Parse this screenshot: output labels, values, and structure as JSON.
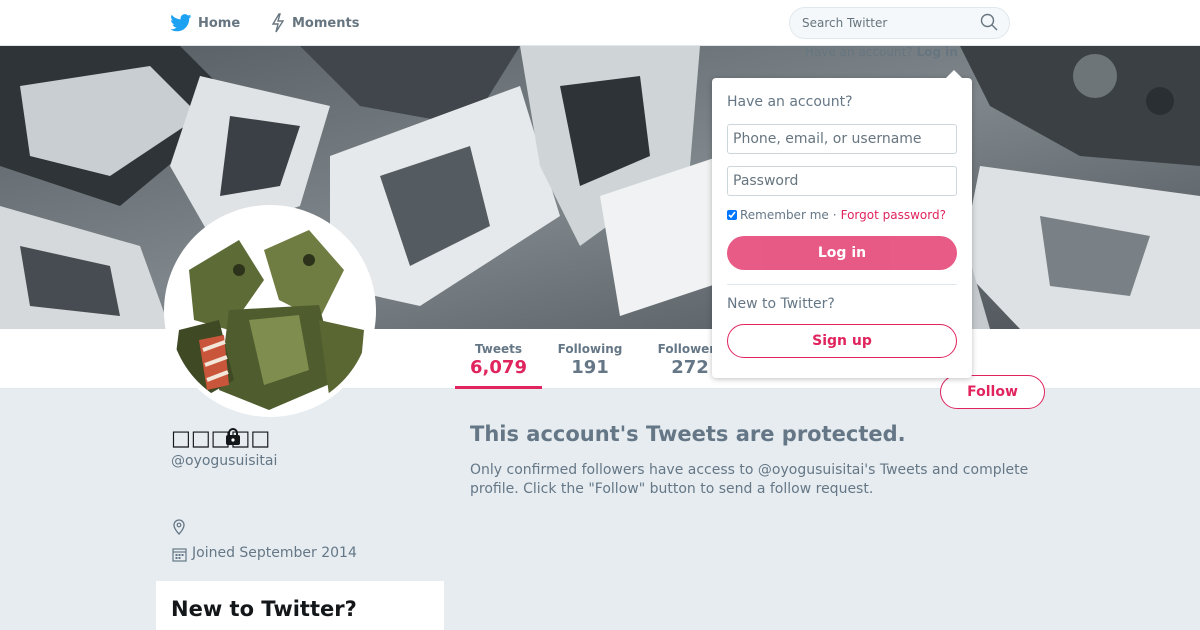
{
  "nav": {
    "home_label": "Home",
    "moments_label": "Moments",
    "search_placeholder": "Search Twitter"
  },
  "login_hint": {
    "question": "Have an account?",
    "link": "Log in"
  },
  "profile": {
    "name": "□□□□□",
    "handle": "@oyogusuisitai",
    "joined": "Joined September 2014"
  },
  "stats": [
    {
      "label": "Tweets",
      "value": "6,079",
      "active": true
    },
    {
      "label": "Following",
      "value": "191"
    },
    {
      "label": "Followers",
      "value": "272"
    }
  ],
  "follow_label": "Follow",
  "protected": {
    "title": "This account's Tweets are protected.",
    "text": "Only confirmed followers have access to @oyogusuisitai's Tweets and complete profile. Click the \"Follow\" button to send a follow request."
  },
  "sidebar_card": {
    "title": "New to Twitter?"
  },
  "login_dropdown": {
    "title": "Have an account?",
    "username_placeholder": "Phone, email, or username",
    "password_placeholder": "Password",
    "remember_label": "Remember me",
    "separator": "·",
    "forgot_label": "Forgot password?",
    "login_button": "Log in",
    "new_label": "New to Twitter?",
    "signup_button": "Sign up"
  },
  "colors": {
    "accent": "#e0245e",
    "muted_text": "#657786",
    "page_bg": "#e6ecf0"
  }
}
